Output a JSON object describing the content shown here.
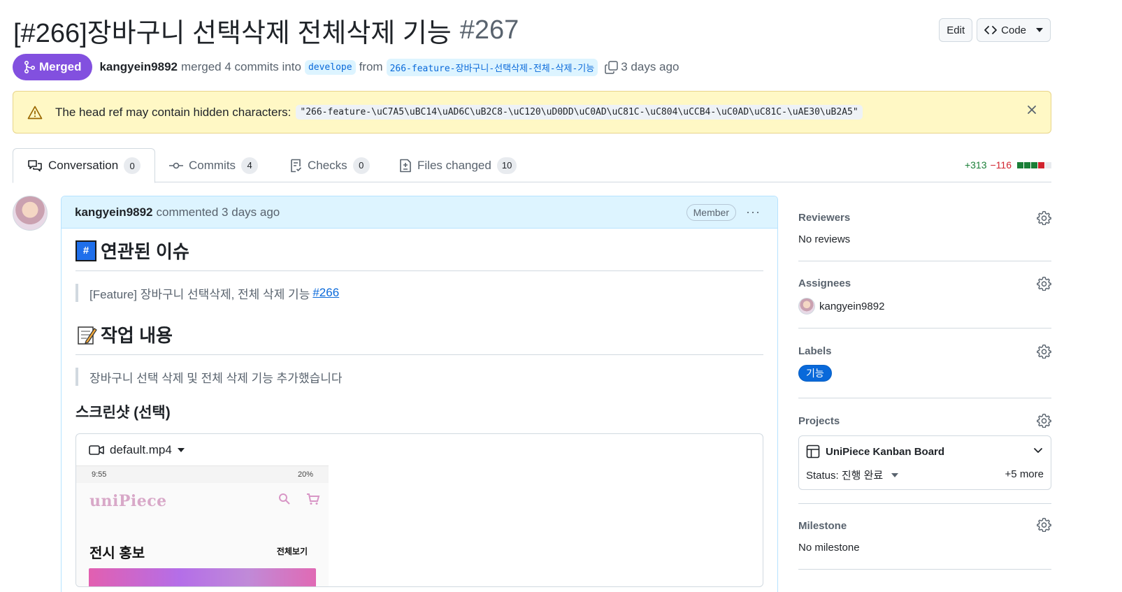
{
  "pr": {
    "title": "[#266]장바구니 선택삭제 전체삭제 기능",
    "number": "#267",
    "state": "Merged",
    "author": "kangyein9892",
    "merge_text": "merged 4 commits into",
    "base_branch": "develope",
    "from_text": "from",
    "head_branch": "266-feature-장바구니-선택삭제-전체-삭제-기능",
    "time": "3 days ago"
  },
  "actions": {
    "edit": "Edit",
    "code": "Code"
  },
  "warning": {
    "text": "The head ref may contain hidden characters:",
    "code": "\"266-feature-\\uC7A5\\uBC14\\uAD6C\\uB2C8-\\uC120\\uD0DD\\uC0AD\\uC81C-\\uC804\\uCCB4-\\uC0AD\\uC81C-\\uAE30\\uB2A5\""
  },
  "tabs": [
    {
      "label": "Conversation",
      "count": "0"
    },
    {
      "label": "Commits",
      "count": "4"
    },
    {
      "label": "Checks",
      "count": "0"
    },
    {
      "label": "Files changed",
      "count": "10"
    }
  ],
  "diffstat": {
    "additions": "+313",
    "deletions": "−116",
    "colors": [
      "#1a7f37",
      "#1a7f37",
      "#1a7f37",
      "#d1242f",
      "#e8ebef"
    ]
  },
  "comment": {
    "author": "kangyein9892",
    "meta": "commented 3 days ago",
    "role": "Member",
    "more": "···",
    "sections": {
      "issue_heading": "연관된 이슈",
      "issue_quote": "[Feature] 장바구니 선택삭제, 전체 삭제 기능",
      "issue_link": "#266",
      "work_heading": "작업 내용",
      "work_quote": "장바구니 선택 삭제 및 전체 삭제 기능 추가했습니다",
      "screenshot_heading": "스크린샷 (선택)"
    },
    "video": {
      "filename": "default.mp4",
      "phone": {
        "time": "9:55",
        "battery": "20%",
        "logo": "uniPiece",
        "section": "전시 홍보",
        "more": "전체보기"
      }
    }
  },
  "sidebar": {
    "reviewers": {
      "title": "Reviewers",
      "value": "No reviews"
    },
    "assignees": {
      "title": "Assignees",
      "value": "kangyein9892"
    },
    "labels": {
      "title": "Labels",
      "value": "기능",
      "color": "#0969da"
    },
    "projects": {
      "title": "Projects",
      "name": "UniPiece Kanban Board",
      "status": "Status: 진행 완료",
      "more": "+5 more"
    },
    "milestone": {
      "title": "Milestone",
      "value": "No milestone"
    }
  },
  "colors": {
    "merged": "#8250df",
    "accent": "#0969da",
    "warning_bg": "#fff8c5",
    "comment_head": "#ddf4ff"
  }
}
